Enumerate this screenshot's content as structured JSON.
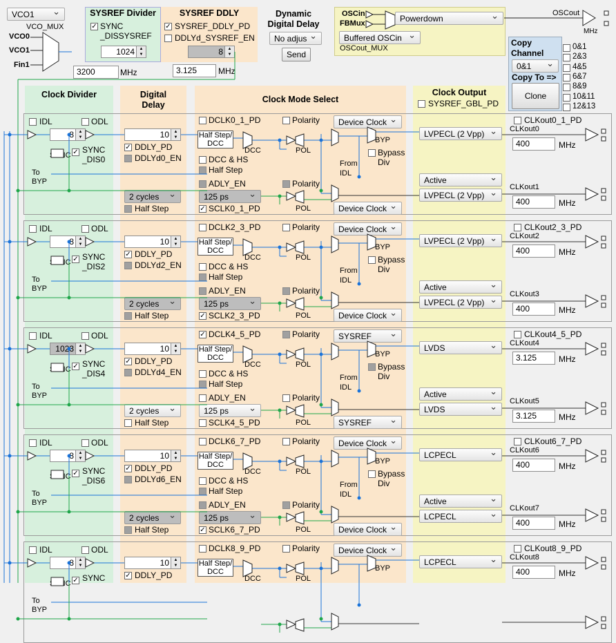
{
  "top": {
    "vco_select": "VCO1",
    "vco_mux_label": "VCO_MUX",
    "vco0": "VCO0",
    "vco1": "VCO1",
    "fin1": "Fin1",
    "vco_freq": "3200",
    "mhz": "MHz",
    "sysref_divider_title": "SYSREF Divider",
    "sync_dis_sysref": "SYNC _DISSYSREF",
    "sysref_div_value": "1024",
    "sysref_ddly_title": "SYSREF DDLY",
    "sysref_ddly_pd": "SYSREF_DDLY_PD",
    "ddlyd_sysref_en": "DDLYd_SYSREF_EN",
    "sysref_ddly_value": "8",
    "sysref_freq": "3.125",
    "dyn_ddly_title": "Dynamic Digital Delay",
    "dyn_ddly_select": "No adjus",
    "send": "Send",
    "oscin": "OSCin",
    "fbmux": "FBMux",
    "oscout_mux_select": "Powerdown",
    "oscout_fmt_select": "Buffered OSCin",
    "oscout_mux_label": "OSCout_MUX",
    "oscout_label": "OSCout",
    "oscout_mhz": "MHz",
    "copy_channel_title": "Copy Channel",
    "copy_select": "0&1",
    "copy_to": "Copy To =>",
    "clone": "Clone",
    "copy_targets": [
      "0&1",
      "2&3",
      "4&5",
      "6&7",
      "8&9",
      "10&11",
      "12&13"
    ]
  },
  "headers": {
    "clock_divider": "Clock Divider",
    "digital_delay": "Digital Delay",
    "clock_mode_select": "Clock Mode Select",
    "clock_output": "Clock Output",
    "sysref_gbl_pd": "SYSREF_GBL_PD"
  },
  "common": {
    "idl": "IDL",
    "odl": "ODL",
    "sync": "SYNC",
    "to_byp": "To BYP",
    "ddly_pd": "DDLY_PD",
    "half_step": "Half Step",
    "half_step_dcc": "Half Step/ DCC",
    "dcc": "DCC",
    "dcc_hs": "DCC & HS",
    "adly_en": "ADLY_EN",
    "polarity": "Polarity",
    "pol": "POL",
    "byp": "BYP",
    "bypass_div": "Bypass Div",
    "from_idl": "From IDL",
    "mhz": "MHz"
  },
  "channels": [
    {
      "div": "8",
      "sync_dis": "SYNC _DIS0",
      "ddly": "10",
      "ddlyd_en": "DDLYd0_EN",
      "cycles": "2 cycles",
      "ps": "125 ps",
      "dclk_pd": "DCLK0_1_PD",
      "sclk_pd": "SCLK0_1_PD",
      "mode_top": "Device Clock",
      "mode_bot": "Device Clock",
      "fmt_top": "LVPECL (2 Vpp)",
      "active": "Active",
      "fmt_bot": "LVPECL (2 Vpp)",
      "clk_pd": "CLKout0_1_PD",
      "clkA": "CLKout0",
      "freqA": "400",
      "clkB": "CLKout1",
      "freqB": "400"
    },
    {
      "div": "8",
      "sync_dis": "SYNC _DIS2",
      "ddly": "10",
      "ddlyd_en": "DDLYd2_EN",
      "cycles": "2 cycles",
      "ps": "125 ps",
      "dclk_pd": "DCLK2_3_PD",
      "sclk_pd": "SCLK2_3_PD",
      "mode_top": "Device Clock",
      "mode_bot": "Device Clock",
      "fmt_top": "LVPECL (2 Vpp)",
      "active": "Active",
      "fmt_bot": "LVPECL (2 Vpp)",
      "clk_pd": "CLKout2_3_PD",
      "clkA": "CLKout2",
      "freqA": "400",
      "clkB": "CLKout3",
      "freqB": "400"
    },
    {
      "div": "1023",
      "sync_dis": "SYNC _DIS4",
      "ddly": "10",
      "ddlyd_en": "DDLYd4_EN",
      "cycles": "2 cycles",
      "ps": "125 ps",
      "dclk_pd": "DCLK4_5_PD",
      "sclk_pd": "SCLK4_5_PD",
      "mode_top": "SYSREF",
      "mode_bot": "SYSREF",
      "fmt_top": "LVDS",
      "active": "Active",
      "fmt_bot": "LVDS",
      "clk_pd": "CLKout4_5_PD",
      "clkA": "CLKout4",
      "freqA": "3.125",
      "clkB": "CLKout5",
      "freqB": "3.125"
    },
    {
      "div": "8",
      "sync_dis": "SYNC _DIS6",
      "ddly": "10",
      "ddlyd_en": "DDLYd6_EN",
      "cycles": "2 cycles",
      "ps": "125 ps",
      "dclk_pd": "DCLK6_7_PD",
      "sclk_pd": "SCLK6_7_PD",
      "mode_top": "Device Clock",
      "mode_bot": "Device Clock",
      "fmt_top": "LCPECL",
      "active": "Active",
      "fmt_bot": "LCPECL",
      "clk_pd": "CLKout6_7_PD",
      "clkA": "CLKout6",
      "freqA": "400",
      "clkB": "CLKout7",
      "freqB": "400"
    },
    {
      "div": "8",
      "sync_dis": "SYNC",
      "ddly": "10",
      "ddlyd_en": "",
      "cycles": "",
      "ps": "",
      "dclk_pd": "DCLK8_9_PD",
      "sclk_pd": "",
      "mode_top": "Device Clock",
      "mode_bot": "",
      "fmt_top": "LCPECL",
      "active": "",
      "fmt_bot": "",
      "clk_pd": "CLKout8_9_PD",
      "clkA": "CLKout8",
      "freqA": "400",
      "clkB": "",
      "freqB": ""
    }
  ]
}
